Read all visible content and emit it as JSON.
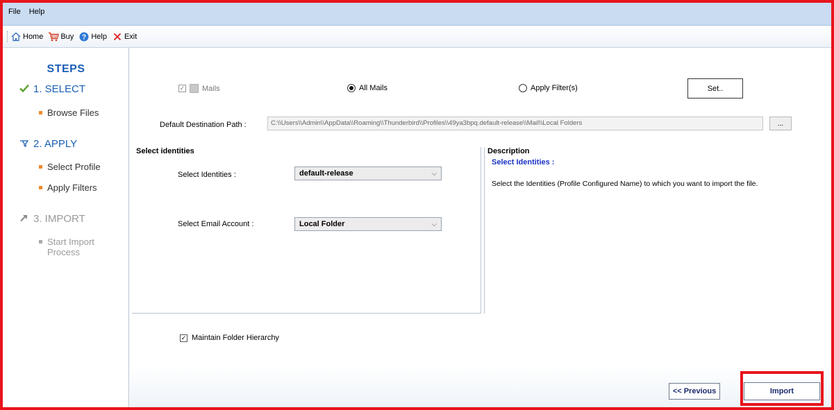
{
  "menubar": {
    "items": [
      "File",
      "Help"
    ]
  },
  "toolbar": {
    "items": [
      {
        "label": "Home",
        "icon": "home-icon"
      },
      {
        "label": "Buy",
        "icon": "cart-icon"
      },
      {
        "label": "Help",
        "icon": "help-icon"
      },
      {
        "label": "Exit",
        "icon": "close-icon"
      }
    ]
  },
  "sidebar": {
    "title": "STEPS",
    "steps": [
      {
        "label": "1. SELECT",
        "state": "done",
        "icon": "checkmark-icon",
        "subs": [
          "Browse Files"
        ]
      },
      {
        "label": "2. APPLY",
        "state": "current",
        "icon": "filter-icon",
        "subs": [
          "Select Profile",
          "Apply Filters"
        ]
      },
      {
        "label": "3. IMPORT",
        "state": "pending",
        "icon": "arrow-icon",
        "subs": [
          "Start Import Process"
        ]
      }
    ]
  },
  "filter_row": {
    "mails_label": "Mails",
    "mails_checked": true,
    "all_mails_label": "All Mails",
    "all_mails_selected": true,
    "apply_filters_label": "Apply Filter(s)",
    "apply_filters_selected": false,
    "set_button": "Set.."
  },
  "destination": {
    "label": "Default Destination Path :",
    "value": "C:\\\\Users\\\\Admin\\\\AppData\\\\Roaming\\\\Thunderbird\\\\Profiles\\\\49ya3bpq.default-release\\\\Mail\\\\Local Folders",
    "browse_button": "..."
  },
  "identities_group": {
    "title": "Select identities",
    "identities_label": "Select Identities :",
    "identities_value": "default-release",
    "account_label": "Select Email Account :",
    "account_value": "Local Folder"
  },
  "description": {
    "title": "Description",
    "subtitle": "Select Identities :",
    "text": "Select the Identities (Profile Configured Name) to  which  you want to import the file."
  },
  "maintain_hierarchy": {
    "label": "Maintain Folder Hierarchy",
    "checked": true
  },
  "nav": {
    "previous": "<< Previous",
    "import": "Import"
  },
  "colors": {
    "accent": "#1a5fb4",
    "highlight": "#e8141c",
    "bullet": "#f0882a",
    "menubar": "#c9dcf2"
  }
}
